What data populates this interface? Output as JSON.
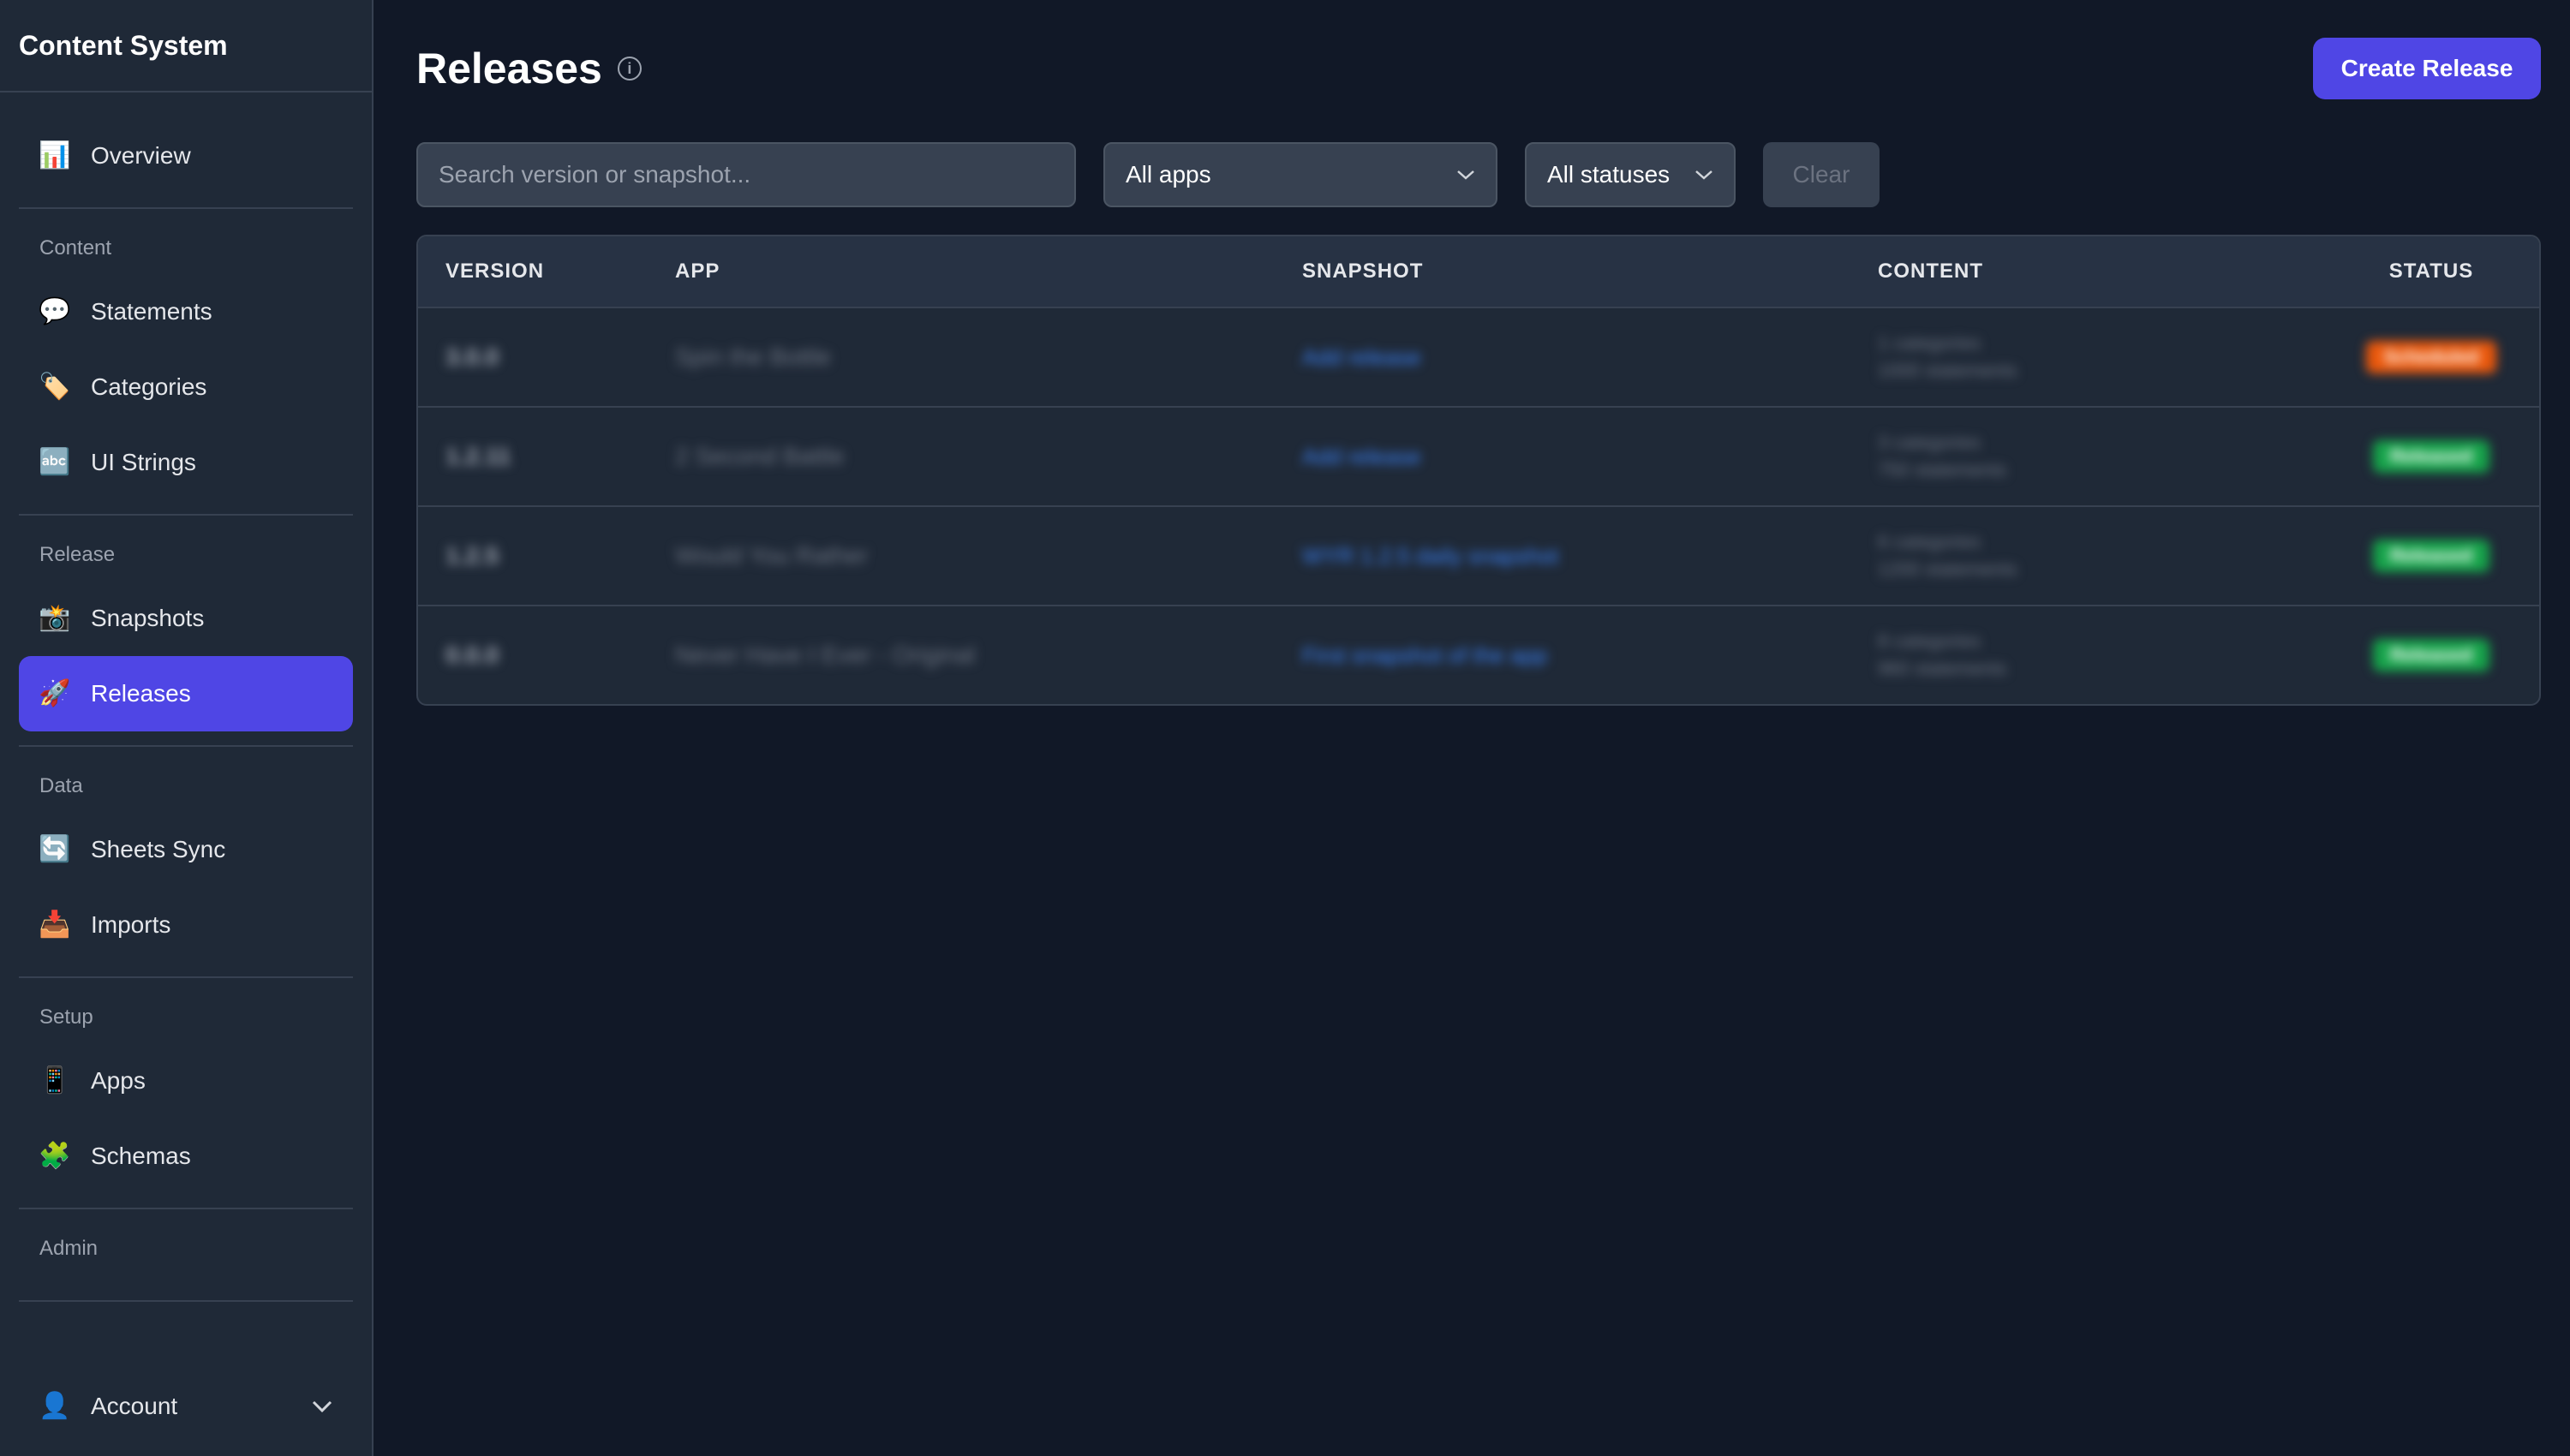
{
  "app": {
    "title": "Content System"
  },
  "sidebar": {
    "overview": {
      "label": "Overview",
      "icon": "bar-chart-icon"
    },
    "sections": [
      {
        "label": "Content",
        "items": [
          {
            "label": "Statements",
            "icon": "speech-bubble-icon"
          },
          {
            "label": "Categories",
            "icon": "tag-icon"
          },
          {
            "label": "UI Strings",
            "icon": "abc-icon"
          }
        ]
      },
      {
        "label": "Release",
        "items": [
          {
            "label": "Snapshots",
            "icon": "camera-flash-icon"
          },
          {
            "label": "Releases",
            "icon": "rocket-icon",
            "active": true
          }
        ]
      },
      {
        "label": "Data",
        "items": [
          {
            "label": "Sheets Sync",
            "icon": "sync-icon"
          },
          {
            "label": "Imports",
            "icon": "inbox-tray-icon"
          }
        ]
      },
      {
        "label": "Setup",
        "items": [
          {
            "label": "Apps",
            "icon": "mobile-phone-icon"
          },
          {
            "label": "Schemas",
            "icon": "puzzle-piece-icon"
          }
        ]
      },
      {
        "label": "Admin",
        "items": []
      }
    ],
    "account": {
      "label": "Account",
      "icon": "user-icon"
    }
  },
  "page": {
    "title": "Releases",
    "create_button": "Create Release"
  },
  "filters": {
    "search_placeholder": "Search version or snapshot...",
    "apps_select": "All apps",
    "status_select": "All statuses",
    "clear_label": "Clear"
  },
  "table": {
    "columns": [
      "VERSION",
      "APP",
      "SNAPSHOT",
      "CONTENT",
      "STATUS"
    ],
    "rows": [
      {
        "version": "3.0.0",
        "app": "Spin the Bottle",
        "snapshot": "Add release",
        "content_1": "1 categories",
        "content_2": "1000 statements",
        "status": "Scheduled",
        "status_color": "#ea580c"
      },
      {
        "version": "1.2.11",
        "app": "2 Second Battle",
        "snapshot": "Add release",
        "content_1": "3 categories",
        "content_2": "750 statements",
        "status": "Released",
        "status_color": "#16a34a"
      },
      {
        "version": "1.2.5",
        "app": "Would You Rather",
        "snapshot": "WYR 1.2.5 daily snapshot",
        "content_1": "6 categories",
        "content_2": "1200 statements",
        "status": "Released",
        "status_color": "#16a34a"
      },
      {
        "version": "0.0.0",
        "app": "Never Have I Ever - Original",
        "snapshot": "First snapshot of the app",
        "content_1": "8 categories",
        "content_2": "960 statements",
        "status": "Released",
        "status_color": "#16a34a"
      }
    ]
  },
  "colors": {
    "accent": "#4f46e5",
    "background": "#111827",
    "panel": "#1f2937"
  }
}
